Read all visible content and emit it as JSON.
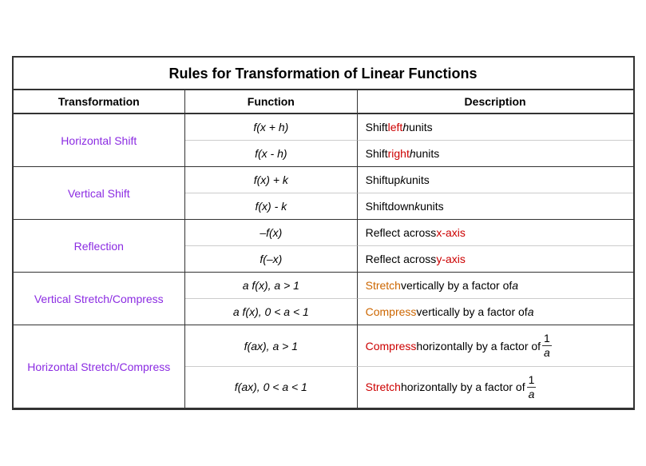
{
  "title": "Rules for Transformation of Linear Functions",
  "headers": [
    "Transformation",
    "Function",
    "Description"
  ],
  "sections": [
    {
      "id": "horizontal-shift",
      "label": "Horizontal Shift",
      "rows": [
        {
          "function": "f(x + h)",
          "desc_parts": [
            {
              "text": "Shift ",
              "color": ""
            },
            {
              "text": "left",
              "color": "red"
            },
            {
              "text": " ",
              "color": ""
            },
            {
              "text": "h",
              "color": "",
              "italic": true
            },
            {
              "text": " units",
              "color": ""
            }
          ]
        },
        {
          "function": "f(x  - h)",
          "desc_parts": [
            {
              "text": "Shift ",
              "color": ""
            },
            {
              "text": "right",
              "color": "red"
            },
            {
              "text": " ",
              "color": ""
            },
            {
              "text": "h",
              "color": "",
              "italic": true
            },
            {
              "text": " units",
              "color": ""
            }
          ]
        }
      ]
    },
    {
      "id": "vertical-shift",
      "label": "Vertical Shift",
      "rows": [
        {
          "function": "f(x) + k",
          "desc_parts": [
            {
              "text": "Shift ",
              "color": ""
            },
            {
              "text": "up",
              "color": ""
            },
            {
              "text": " ",
              "color": ""
            },
            {
              "text": "k",
              "color": "",
              "italic": true
            },
            {
              "text": " units",
              "color": ""
            }
          ]
        },
        {
          "function": "f(x) - k",
          "desc_parts": [
            {
              "text": "Shift ",
              "color": ""
            },
            {
              "text": "down",
              "color": ""
            },
            {
              "text": " ",
              "color": ""
            },
            {
              "text": "k",
              "color": "",
              "italic": true
            },
            {
              "text": " units",
              "color": ""
            }
          ]
        }
      ]
    },
    {
      "id": "reflection",
      "label": "Reflection",
      "rows": [
        {
          "function": "–f(x)",
          "desc_parts": [
            {
              "text": "Reflect across ",
              "color": ""
            },
            {
              "text": "x-axis",
              "color": "red"
            }
          ]
        },
        {
          "function": "f(–x)",
          "desc_parts": [
            {
              "text": "Reflect across ",
              "color": ""
            },
            {
              "text": "y-axis",
              "color": "red"
            }
          ]
        }
      ]
    },
    {
      "id": "vertical-stretch",
      "label": "Vertical Stretch/Compress",
      "rows": [
        {
          "function": "a f(x), a > 1",
          "desc_parts": [
            {
              "text": "Stretch",
              "color": "orange"
            },
            {
              "text": " vertically by a factor of ",
              "color": ""
            },
            {
              "text": "a",
              "color": "",
              "italic": true
            }
          ]
        },
        {
          "function": "a f(x), 0 < a < 1",
          "desc_parts": [
            {
              "text": "Compress",
              "color": "orange"
            },
            {
              "text": " vertically by a factor of ",
              "color": ""
            },
            {
              "text": "a",
              "color": "",
              "italic": true
            }
          ]
        }
      ]
    },
    {
      "id": "horizontal-stretch",
      "label": "Horizontal Stretch/Compress",
      "rows": [
        {
          "function": "f(ax), a > 1",
          "desc_parts": [
            {
              "text": "Compress",
              "color": "red"
            },
            {
              "text": " horizontally by a factor of ",
              "color": ""
            },
            {
              "text": "fraction_1_a",
              "color": ""
            }
          ]
        },
        {
          "function": "f(ax), 0 < a < 1",
          "desc_parts": [
            {
              "text": "Stretch",
              "color": "red"
            },
            {
              "text": " horizontally by a factor of ",
              "color": ""
            },
            {
              "text": "fraction_1_a",
              "color": ""
            }
          ]
        }
      ]
    }
  ]
}
